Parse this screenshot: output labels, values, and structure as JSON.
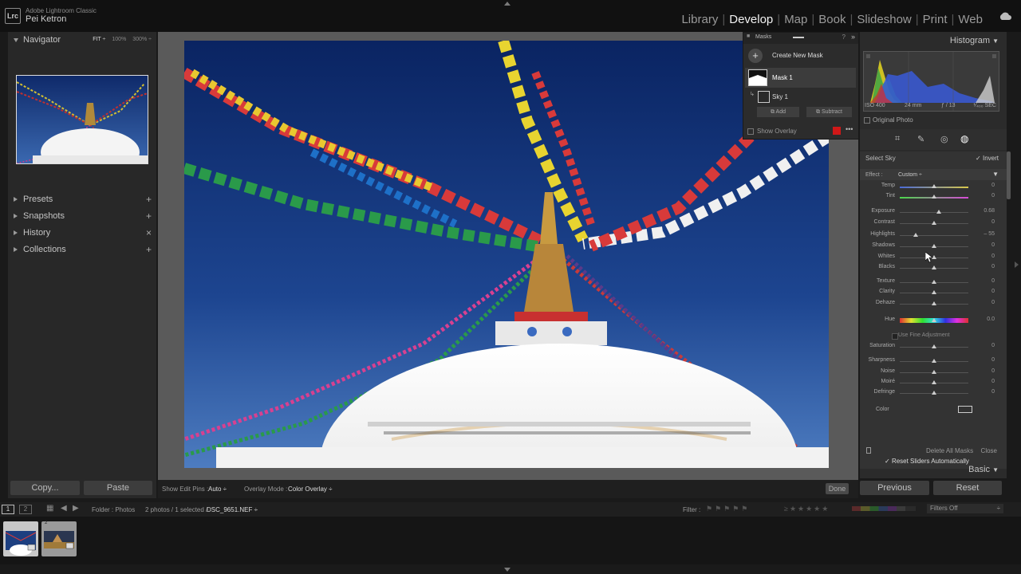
{
  "app": {
    "name": "Adobe Lightroom Classic",
    "logo": "Lrc",
    "user": "Pei Ketron"
  },
  "modules": [
    {
      "label": "Library"
    },
    {
      "label": "Develop",
      "active": true
    },
    {
      "label": "Map"
    },
    {
      "label": "Book"
    },
    {
      "label": "Slideshow"
    },
    {
      "label": "Print"
    },
    {
      "label": "Web"
    }
  ],
  "left": {
    "navigator": {
      "title": "Navigator",
      "zoom_fit": "FIT ÷",
      "zoom_100": "100%",
      "zoom_300": "300% ÷"
    },
    "panels": [
      {
        "label": "Presets",
        "action": "+"
      },
      {
        "label": "Snapshots",
        "action": "+"
      },
      {
        "label": "History",
        "action": "×"
      },
      {
        "label": "Collections",
        "action": "+"
      }
    ],
    "copy_label": "Copy...",
    "paste_label": "Paste"
  },
  "masks": {
    "title": "Masks",
    "create_label": "Create New Mask",
    "mask1_label": "Mask 1",
    "sky_label": "Sky 1",
    "add_label": "Add",
    "subtract_label": "Subtract",
    "show_overlay_label": "Show Overlay",
    "overlay_color": "#d01818"
  },
  "toolbar": {
    "show_edit_pins_label": "Show Edit Pins :",
    "show_edit_pins_value": "Auto ÷",
    "overlay_mode_label": "Overlay Mode :",
    "overlay_mode_value": "Color Overlay ÷",
    "done_label": "Done"
  },
  "right": {
    "histogram_title": "Histogram",
    "iso": "ISO 400",
    "focal": "24 mm",
    "aperture": "ƒ / 13",
    "shutter": "¹⁄₄₀₀ SEC",
    "original_photo_label": "Original Photo",
    "select_sky": "Select Sky",
    "invert_label": "Invert",
    "effect_label": "Effect :",
    "effect_value": "Custom ÷",
    "sliders": [
      {
        "label": "Temp",
        "value": "0",
        "pos": 0.5,
        "kind": "temp"
      },
      {
        "label": "Tint",
        "value": "0",
        "pos": 0.5,
        "kind": "tint"
      },
      {
        "label": "Exposure",
        "value": "0.68",
        "pos": 0.57
      },
      {
        "label": "Contrast",
        "value": "0",
        "pos": 0.5
      },
      {
        "label": "Highlights",
        "value": "– 55",
        "pos": 0.23
      },
      {
        "label": "Shadows",
        "value": "0",
        "pos": 0.5
      },
      {
        "label": "Whites",
        "value": "0",
        "pos": 0.5
      },
      {
        "label": "Blacks",
        "value": "0",
        "pos": 0.5
      },
      {
        "label": "Texture",
        "value": "0",
        "pos": 0.5
      },
      {
        "label": "Clarity",
        "value": "0",
        "pos": 0.5
      },
      {
        "label": "Dehaze",
        "value": "0",
        "pos": 0.5
      },
      {
        "label": "Hue",
        "value": "0.0",
        "pos": 0.5,
        "kind": "hue"
      },
      {
        "label": "Saturation",
        "value": "0",
        "pos": 0.5
      },
      {
        "label": "Sharpness",
        "value": "0",
        "pos": 0.5
      },
      {
        "label": "Noise",
        "value": "0",
        "pos": 0.5
      },
      {
        "label": "Moiré",
        "value": "0",
        "pos": 0.5
      },
      {
        "label": "Defringe",
        "value": "0",
        "pos": 0.5
      }
    ],
    "fine_adjust_label": "Use Fine Adjustment",
    "color_label": "Color",
    "reset_auto_label": "Reset Sliders Automatically",
    "delete_all_label": "Delete All Masks",
    "close_label": "Close",
    "basic_label": "Basic",
    "previous_label": "Previous",
    "reset_label": "Reset"
  },
  "filmstrip": {
    "page1": "1",
    "page2": "2",
    "folder": "Folder : Photos",
    "count": "2 photos / 1 selected /",
    "filename": "DSC_9651.NEF ÷",
    "filter_label": "Filter :",
    "filters_off": "Filters Off",
    "thumb2_num": "2"
  }
}
